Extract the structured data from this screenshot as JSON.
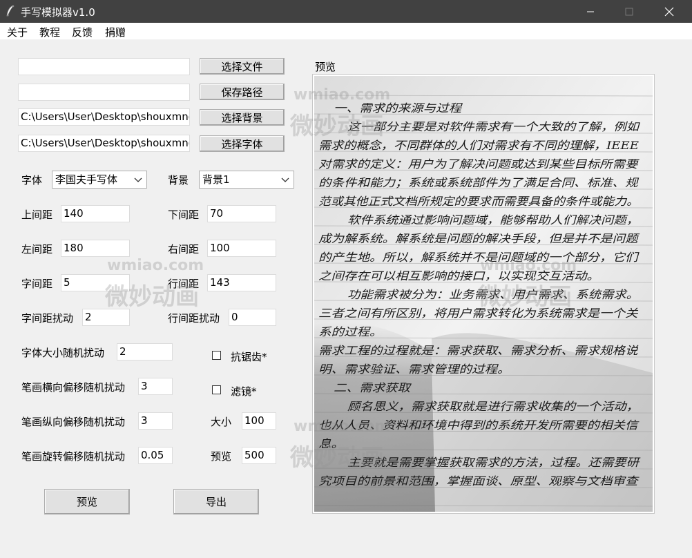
{
  "window": {
    "title": "手写模拟器v1.0"
  },
  "menu": {
    "items": [
      "关于",
      "教程",
      "反馈",
      "捐赠"
    ]
  },
  "files": {
    "source_path": "",
    "save_path": "",
    "background_path": "C:\\Users\\User\\Desktop\\shouxmnq",
    "font_path": "C:\\Users\\User\\Desktop\\shouxmnq",
    "select_file_label": "选择文件",
    "save_path_label": "保存路径",
    "select_background_label": "选择背景",
    "select_font_label": "选择字体"
  },
  "settings": {
    "font_label": "字体",
    "font_value": "李国夫手写体",
    "background_label": "背景",
    "background_value": "背景1",
    "top_margin_label": "上间距",
    "top_margin": "140",
    "bottom_margin_label": "下间距",
    "bottom_margin": "70",
    "left_margin_label": "左间距",
    "left_margin": "180",
    "right_margin_label": "右间距",
    "right_margin": "100",
    "char_spacing_label": "字间距",
    "char_spacing": "5",
    "line_spacing_label": "行间距",
    "line_spacing": "143",
    "char_spacing_jitter_label": "字间距扰动",
    "char_spacing_jitter": "2",
    "line_spacing_jitter_label": "行间距扰动",
    "line_spacing_jitter": "0",
    "font_size_jitter_label": "字体大小随机扰动",
    "font_size_jitter": "2",
    "stroke_h_offset_label": "笔画横向偏移随机扰动",
    "stroke_h_offset": "3",
    "stroke_v_offset_label": "笔画纵向偏移随机扰动",
    "stroke_v_offset": "3",
    "stroke_rotation_label": "笔画旋转偏移随机扰动",
    "stroke_rotation": "0.05",
    "antialias_label": "抗锯齿*",
    "antialias_checked": false,
    "filter_label": "滤镜*",
    "filter_checked": false,
    "size_label": "大小",
    "size": "100",
    "preview_size_label": "预览",
    "preview_size": "500"
  },
  "actions": {
    "preview_label": "预览",
    "export_label": "导出"
  },
  "preview": {
    "title": "预览",
    "lines": [
      "一、需求的来源与过程",
      "这一部分主要是对软件需求有一个大致的了解，例如",
      "需求的概念，不同群体的人们对需求有不同的理解，IEEE",
      "对需求的定义：用户为了解决问题或达到某些目标所需要",
      "的条件和能力；系统或系统部件为了满足合同、标准、规",
      "范或其他正式文档所规定的要求而需要具备的条件或能力。",
      "软件系统通过影响问题域，能够帮助人们解决问题，",
      "成为解系统。解系统是问题的解决手段，但是并不是问题",
      "的产生地。所以，解系统并不是问题域的一个部分，它们",
      "之间存在可以相互影响的接口，以实现交互活动。",
      "功能需求被分为：业务需求、用户需求、系统需求。",
      "三者之间有所区别，将用户需求转化为系统需求是一个关",
      "系的过程。",
      "需求工程的过程就是：需求获取、需求分析、需求规格说",
      "明、需求验证、需求管理的过程。",
      "二、需求获取",
      "顾名思义，需求获取就是进行需求收集的一个活动，",
      "也从人员、资料和环境中得到的系统开发所需要的相关信",
      "息。",
      "主要就是需要掌握获取需求的方法，过程。还需要研",
      "究项目的前景和范围，掌握面谈、原型、观察与文档审查"
    ]
  },
  "watermark": {
    "url": "wmiao.com",
    "cn": "微妙动画"
  }
}
